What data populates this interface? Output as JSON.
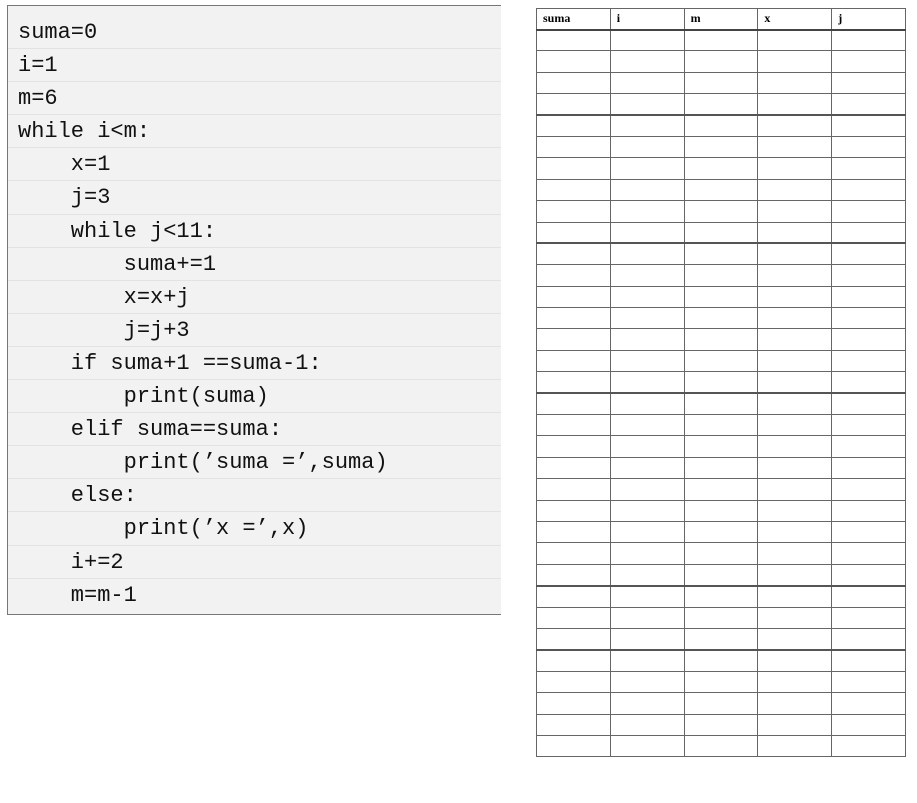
{
  "code": {
    "lines": [
      "suma=0",
      "i=1",
      "m=6",
      "while i<m:",
      "    x=1",
      "    j=3",
      "    while j<11:",
      "        suma+=1",
      "        x=x+j",
      "        j=j+3",
      "    if suma+1 ==suma-1:",
      "        print(suma)",
      "    elif suma==suma:",
      "        print(’suma =’,suma)",
      "    else:",
      "        print(’x =’,x)",
      "    i+=2",
      "    m=m-1"
    ]
  },
  "trace_table": {
    "headers": [
      "suma",
      "i",
      "m",
      "x",
      "j"
    ],
    "empty_rows": 34
  }
}
